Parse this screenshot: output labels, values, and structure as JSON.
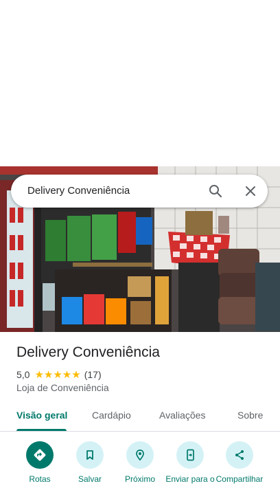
{
  "search": {
    "query": "Delivery Conveniência"
  },
  "place": {
    "name": "Delivery Conveniência",
    "rating": "5,0",
    "stars": "★★★★★",
    "review_count": "(17)",
    "category": "Loja de Conveniência"
  },
  "tabs": [
    {
      "label": "Visão geral",
      "active": true
    },
    {
      "label": "Cardápio"
    },
    {
      "label": "Avaliações"
    },
    {
      "label": "Sobre"
    }
  ],
  "actions": [
    {
      "label": "Rotas",
      "icon": "directions-icon"
    },
    {
      "label": "Salvar",
      "icon": "bookmark-icon"
    },
    {
      "label": "Próximo",
      "icon": "nearby-icon"
    },
    {
      "label": "Enviar para o",
      "icon": "send-to-phone-icon"
    },
    {
      "label": "Compartilhar",
      "icon": "share-icon"
    }
  ],
  "colors": {
    "accent": "#00796b",
    "action_bg": "#d4f2f6",
    "star": "#fbbc04"
  }
}
